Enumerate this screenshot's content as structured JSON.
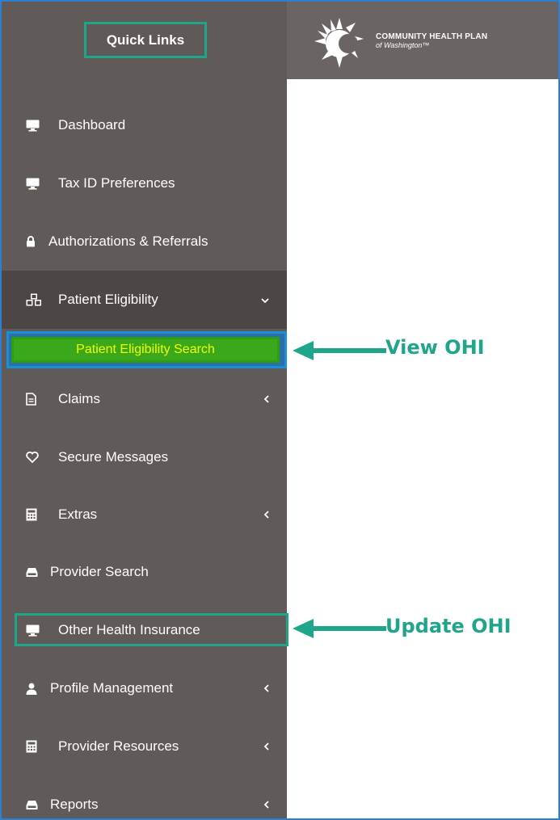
{
  "header": {
    "quick_links_label": "Quick Links",
    "logo_line1": "COMMUNITY HEALTH PLAN",
    "logo_line2": "of Washington™"
  },
  "sidebar": {
    "items": [
      {
        "label": "Dashboard",
        "icon": "monitor-icon"
      },
      {
        "label": "Tax ID Preferences",
        "icon": "monitor-icon"
      },
      {
        "label": "Authorizations & Referrals",
        "icon": "lock-icon"
      },
      {
        "label": "Patient Eligibility",
        "icon": "cubes-icon",
        "expanded": true
      },
      {
        "label": "Claims",
        "icon": "file-icon"
      },
      {
        "label": "Secure Messages",
        "icon": "heart-icon"
      },
      {
        "label": "Extras",
        "icon": "calculator-icon"
      },
      {
        "label": "Provider Search",
        "icon": "hdd-icon"
      },
      {
        "label": "Other Health Insurance",
        "icon": "monitor-icon"
      },
      {
        "label": "Profile Management",
        "icon": "user-icon"
      },
      {
        "label": "Provider Resources",
        "icon": "calculator-icon"
      },
      {
        "label": "Reports",
        "icon": "hdd-icon"
      }
    ],
    "subitem": {
      "label": "Patient Eligibility Search"
    }
  },
  "annotations": {
    "view": "View OHI",
    "update": "Update OHI",
    "color": "#1ea58a"
  }
}
